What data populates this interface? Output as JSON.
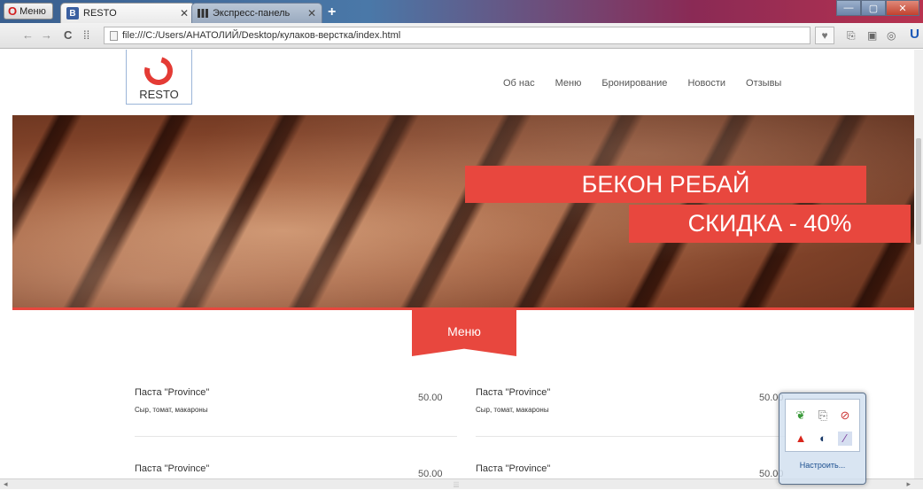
{
  "browser": {
    "menu_label": "Меню",
    "tabs": [
      {
        "label": "RESTO",
        "active": true
      },
      {
        "label": "Экспресс-панель",
        "active": false
      }
    ],
    "new_tab": "+",
    "address": "file:///C:/Users/АНАТОЛИЙ/Desktop/кулаков-верстка/index.html"
  },
  "site": {
    "logo_text": "RESTO",
    "nav": [
      "Об нас",
      "Меню",
      "Бронирование",
      "Новости",
      "Отзывы"
    ],
    "promo_line1": "БЕКОН РЕБАЙ",
    "promo_line2": "СКИДКА - 40%",
    "section_title": "Меню",
    "menu_items": [
      {
        "name": "Паста \"Province\"",
        "desc": "Сыр, томат, макароны",
        "price": "50.00"
      },
      {
        "name": "Паста \"Province\"",
        "desc": "Сыр, томат, макароны",
        "price": "50.00"
      },
      {
        "name": "Паста \"Province\"",
        "desc": "",
        "price": "50.00"
      },
      {
        "name": "Паста \"Province\"",
        "desc": "",
        "price": "50.00"
      }
    ]
  },
  "tray": {
    "customize_label": "Настроить..."
  },
  "colors": {
    "accent": "#e8473e"
  }
}
